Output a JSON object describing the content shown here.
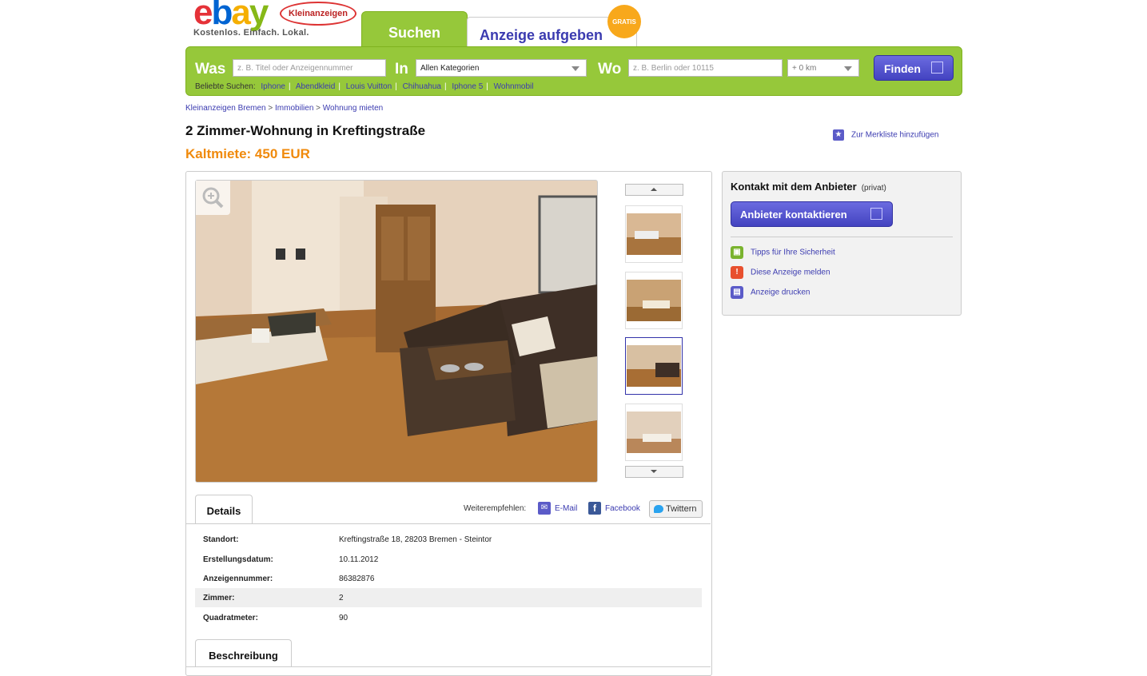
{
  "header": {
    "logo": "ebay",
    "badge": "Kleinanzeigen",
    "tagline": "Kostenlos. Einfach. Lokal.",
    "tab_search": "Suchen",
    "tab_post": "Anzeige aufgeben",
    "gratis": "GRATIS"
  },
  "search": {
    "was_label": "Was",
    "was_placeholder": "z. B. Titel oder Anzeigennummer",
    "in_label": "In",
    "category": "Allen Kategorien",
    "wo_label": "Wo",
    "wo_placeholder": "z. B. Berlin oder 10115",
    "radius": "+ 0 km",
    "submit": "Finden",
    "popular_label": "Beliebte Suchen:",
    "popular": [
      "Iphone",
      "Abendkleid",
      "Louis Vuitton",
      "Chihuahua",
      "Iphone 5",
      "Wohnmobil"
    ]
  },
  "breadcrumb": [
    "Kleinanzeigen Bremen",
    "Immobilien",
    "Wohnung mieten"
  ],
  "listing": {
    "title": "2 Zimmer-Wohnung in Kreftingstraße",
    "price": "Kaltmiete: 450 EUR",
    "watchlist": "Zur Merkliste hinzufügen"
  },
  "tabs": {
    "details": "Details",
    "description": "Beschreibung"
  },
  "share": {
    "label": "Weiterempfehlen:",
    "email": "E-Mail",
    "facebook": "Facebook",
    "twitter": "Twittern"
  },
  "details": [
    {
      "key": "Standort:",
      "value": "Kreftingstraße 18, 28203 Bremen - Steintor"
    },
    {
      "key": "Erstellungsdatum:",
      "value": "10.11.2012"
    },
    {
      "key": "Anzeigennummer:",
      "value": "86382876"
    },
    {
      "key": "Zimmer:",
      "value": "2"
    },
    {
      "key": "Quadratmeter:",
      "value": "90"
    }
  ],
  "contact": {
    "title": "Kontakt mit dem Anbieter",
    "type": "(privat)",
    "button": "Anbieter kontaktieren",
    "actions": [
      {
        "label": "Tipps für Ihre Sicherheit",
        "icon": "lock-icon",
        "color": "#7ab32e"
      },
      {
        "label": "Diese Anzeige melden",
        "icon": "alert-icon",
        "color": "#e8502e"
      },
      {
        "label": "Anzeige drucken",
        "icon": "print-icon",
        "color": "#5b5bc8"
      }
    ]
  },
  "colors": {
    "accent_green": "#96c83a",
    "link_blue": "#3b3bb0",
    "price_orange": "#f08a0c",
    "button_purple": "#4343c0"
  }
}
